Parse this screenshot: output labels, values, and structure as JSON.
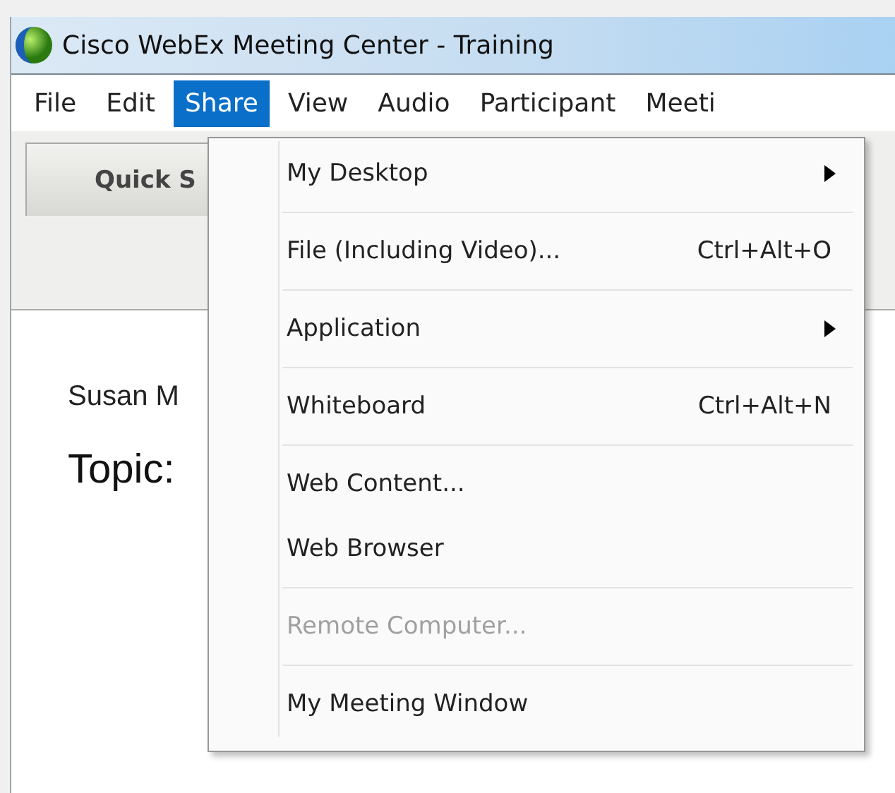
{
  "window": {
    "title": "Cisco WebEx Meeting Center - Training"
  },
  "menu_bar": [
    {
      "label": "File",
      "selected": false
    },
    {
      "label": "Edit",
      "selected": false
    },
    {
      "label": "Share",
      "selected": true
    },
    {
      "label": "View",
      "selected": false
    },
    {
      "label": "Audio",
      "selected": false
    },
    {
      "label": "Participant",
      "selected": false
    },
    {
      "label": "Meeti",
      "selected": false
    }
  ],
  "tabs": [
    {
      "label": "Quick S",
      "selected": true
    }
  ],
  "content": {
    "host": "Susan M",
    "topic": "Topic:"
  },
  "share_menu": [
    {
      "kind": "item",
      "label": "My Desktop",
      "submenu": true,
      "disabled": false
    },
    {
      "kind": "separator"
    },
    {
      "kind": "item",
      "label": "File (Including Video)...",
      "shortcut": "Ctrl+Alt+O",
      "disabled": false
    },
    {
      "kind": "separator"
    },
    {
      "kind": "item",
      "label": "Application",
      "submenu": true,
      "disabled": false
    },
    {
      "kind": "separator"
    },
    {
      "kind": "item",
      "label": "Whiteboard",
      "shortcut": "Ctrl+Alt+N",
      "disabled": false
    },
    {
      "kind": "separator"
    },
    {
      "kind": "item",
      "label": "Web Content...",
      "disabled": false
    },
    {
      "kind": "item",
      "label": "Web Browser",
      "disabled": false
    },
    {
      "kind": "separator"
    },
    {
      "kind": "item",
      "label": "Remote Computer...",
      "disabled": true
    },
    {
      "kind": "separator"
    },
    {
      "kind": "item",
      "label": "My Meeting Window",
      "disabled": false
    }
  ]
}
